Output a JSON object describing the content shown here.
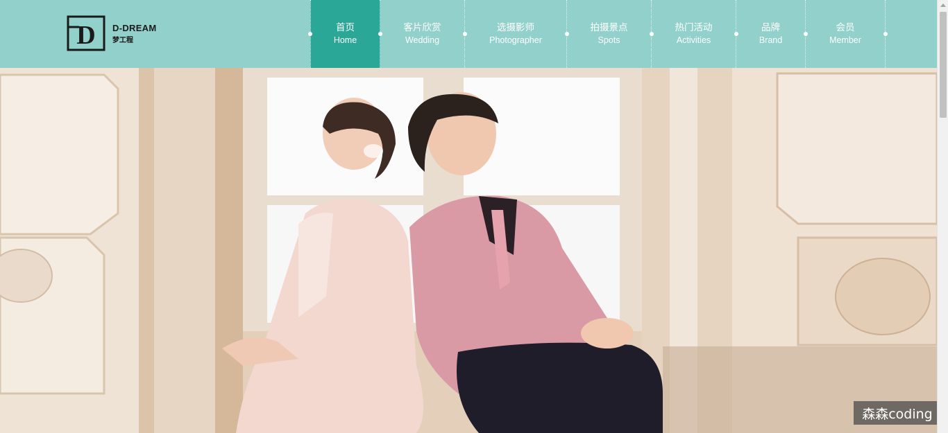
{
  "logo": {
    "name": "D-DREAM",
    "subtitle": "梦工程",
    "mark_letter": "D"
  },
  "nav": {
    "items": [
      {
        "cn": "首页",
        "en": "Home",
        "active": true
      },
      {
        "cn": "客片欣赏",
        "en": "Wedding",
        "active": false
      },
      {
        "cn": "选摄影师",
        "en": "Photographer",
        "active": false
      },
      {
        "cn": "拍摄景点",
        "en": "Spots",
        "active": false
      },
      {
        "cn": "热门活动",
        "en": "Activities",
        "active": false
      },
      {
        "cn": "品牌",
        "en": "Brand",
        "active": false
      },
      {
        "cn": "会员",
        "en": "Member",
        "active": false
      }
    ]
  },
  "watermark": {
    "text": "森森coding"
  },
  "colors": {
    "header_bg": "#92d0cb",
    "active_bg": "#2ba797",
    "nav_text": "#ffffff"
  }
}
